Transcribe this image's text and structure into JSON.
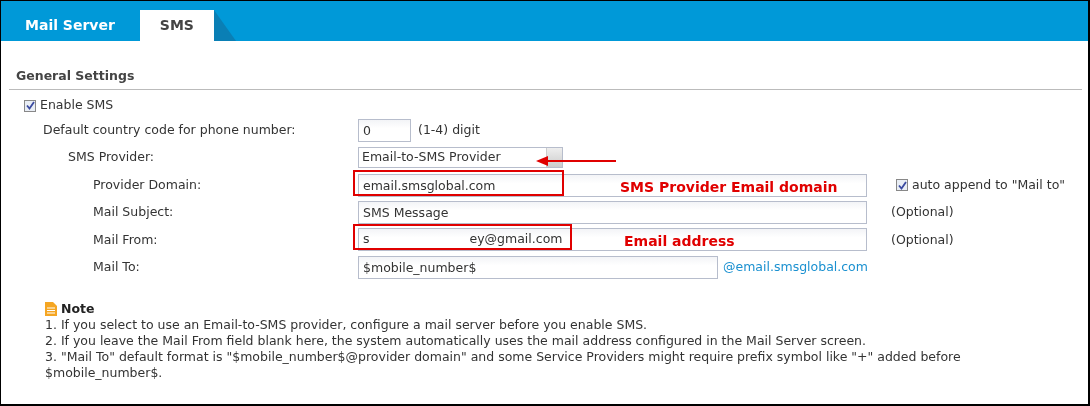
{
  "tabs": [
    {
      "label": "Mail Server",
      "selected": false
    },
    {
      "label": "SMS",
      "selected": true
    }
  ],
  "section_title": "General Settings",
  "enable_sms": {
    "label": "Enable SMS",
    "checked": true
  },
  "fields": [
    {
      "kind": "text",
      "label": "Default country code for phone number:",
      "value": "0",
      "hint": "(1-4) digit"
    },
    {
      "kind": "select",
      "label": "SMS Provider:",
      "value": "Email-to-SMS Provider",
      "annotation": {
        "kind": "arrow"
      }
    },
    {
      "kind": "text",
      "label": "Provider Domain:",
      "value": "email.smsglobal.com",
      "annotation": {
        "kind": "box",
        "text": "SMS Provider Email domain"
      },
      "checkbox": {
        "label": "auto append to \"Mail to\"",
        "checked": true
      }
    },
    {
      "kind": "text",
      "label": "Mail Subject:",
      "value": "SMS Message",
      "hint": "(Optional)"
    },
    {
      "kind": "redacted",
      "label": "Mail From:",
      "value_start": "s",
      "value_end": "ey@gmail.com",
      "annotation": {
        "kind": "box",
        "text": "Email address"
      },
      "hint": "(Optional)"
    },
    {
      "kind": "text",
      "label": "Mail To:",
      "value": "$mobile_number$",
      "suffix": "@email.smsglobal.com"
    }
  ],
  "note": {
    "title": "Note",
    "items": [
      "1. If you select to use an Email-to-SMS provider, configure a mail server before you enable SMS.",
      "2. If you leave the Mail From field blank here, the system automatically uses the mail address configured in the Mail Server screen.",
      "3. \"Mail To\" default format is \"$mobile_number$@provider domain\" and some Service Providers might require prefix symbol like \"+\" added before $mobile_number$."
    ]
  }
}
